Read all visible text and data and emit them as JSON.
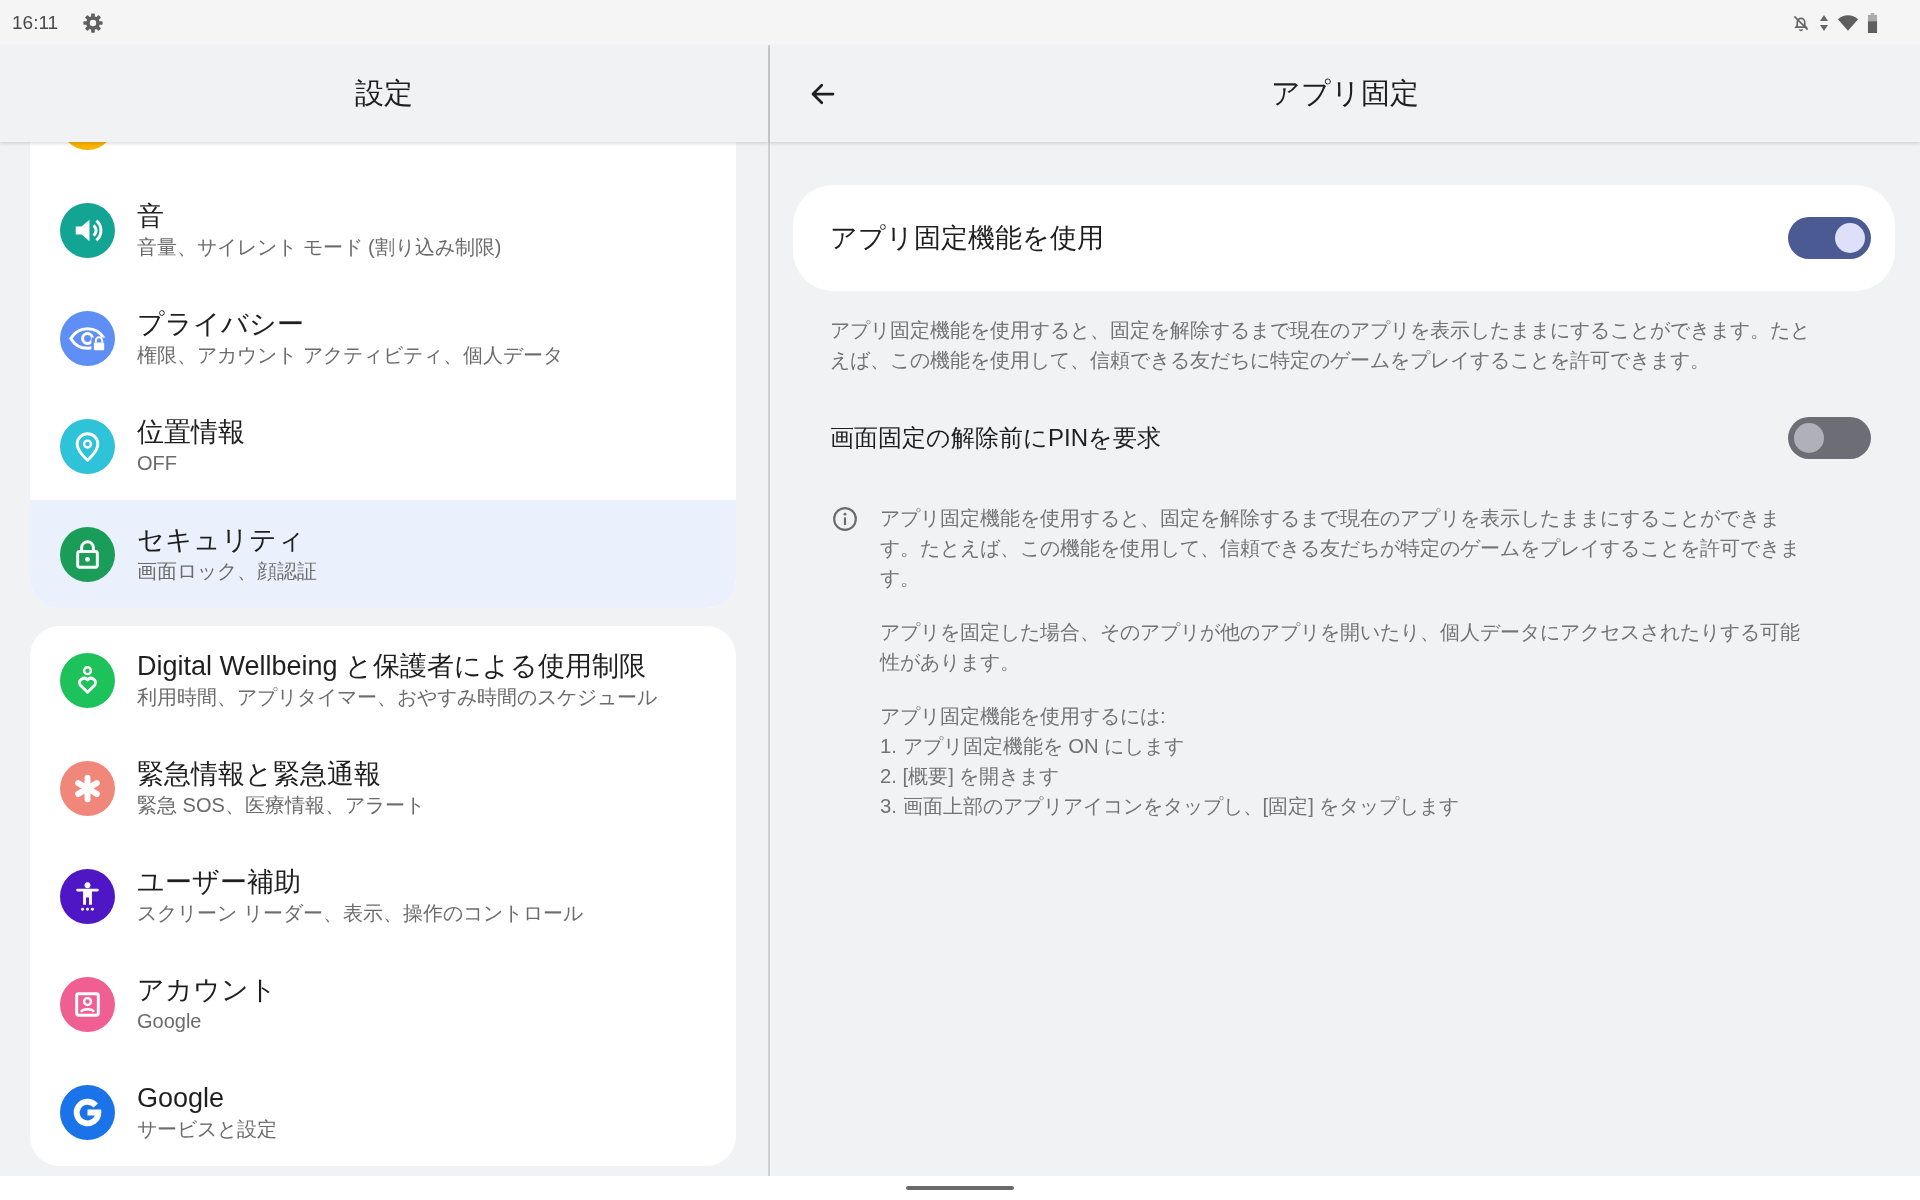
{
  "status_bar": {
    "time": "16:11"
  },
  "settings_pane": {
    "title": "設定",
    "groups": [
      {
        "items": [
          {
            "color": "#f9b400",
            "selected": false
          },
          {
            "title": "音",
            "subtitle": "音量、サイレント モード (割り込み制限)",
            "color": "#12a594",
            "selected": false
          },
          {
            "title": "プライバシー",
            "subtitle": "権限、アカウント アクティビティ、個人データ",
            "color": "#5f8ff5",
            "selected": false
          },
          {
            "title": "位置情報",
            "subtitle": "OFF",
            "color": "#2fc3d9",
            "selected": false
          },
          {
            "title": "セキュリティ",
            "subtitle": "画面ロック、顔認証",
            "color": "#1a9d58",
            "selected": true
          }
        ]
      },
      {
        "items": [
          {
            "title": "Digital Wellbeing と保護者による使用制限",
            "subtitle": "利用時間、アプリタイマー、おやすみ時間のスケジュール",
            "color": "#1ec25a",
            "selected": false
          },
          {
            "title": "緊急情報と緊急通報",
            "subtitle": "緊急 SOS、医療情報、アラート",
            "color": "#f0877a",
            "selected": false
          },
          {
            "title": "ユーザー補助",
            "subtitle": "スクリーン リーダー、表示、操作のコントロール",
            "color": "#4f16c6",
            "selected": false
          },
          {
            "title": "アカウント",
            "subtitle": "Google",
            "color": "#ef5f92",
            "selected": false
          },
          {
            "title": "Google",
            "subtitle": "サービスと設定",
            "color": "#1a73e8",
            "selected": false
          }
        ]
      }
    ]
  },
  "app_pinning": {
    "title": "アプリ固定",
    "main_toggle": {
      "label": "アプリ固定機能を使用",
      "on": true
    },
    "description": "アプリ固定機能を使用すると、固定を解除するまで現在のアプリを表示したままにすることができます。たとえば、この機能を使用して、信頼できる友だちに特定のゲームをプレイすることを許可できます。",
    "pin_toggle": {
      "label": "画面固定の解除前にPINを要求",
      "on": false
    },
    "info": {
      "paragraphs": [
        "アプリ固定機能を使用すると、固定を解除するまで現在のアプリを表示したままにすることができます。たとえば、この機能を使用して、信頼できる友だちが特定のゲームをプレイすることを許可できます。",
        "アプリを固定した場合、そのアプリが他のアプリを開いたり、個人データにアクセスされたりする可能性があります。"
      ],
      "steps_heading": "アプリ固定機能を使用するには:",
      "steps": [
        "1. アプリ固定機能を ON にします",
        "2. [概要] を開きます",
        "3. 画面上部のアプリアイコンをタップし、[固定] をタップします"
      ]
    }
  }
}
